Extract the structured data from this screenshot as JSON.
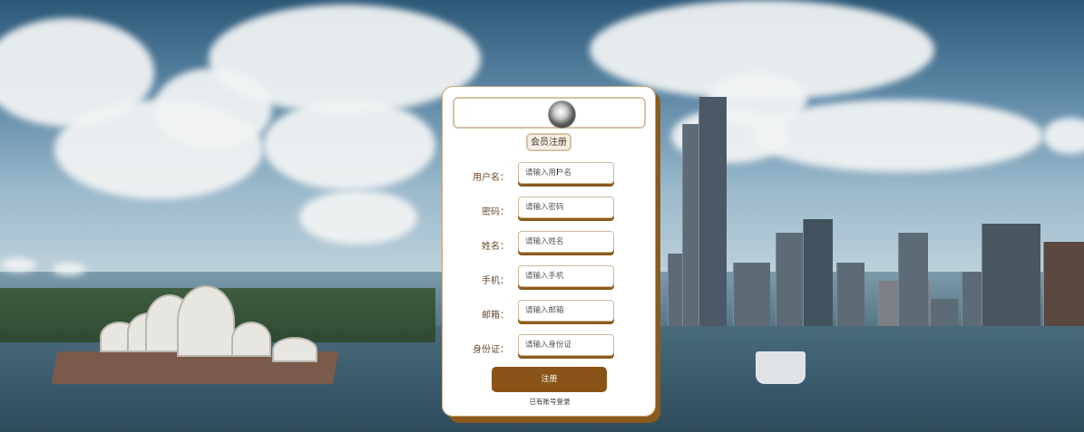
{
  "register": {
    "title_label": "会员注册",
    "fields": [
      {
        "label": "用户名：",
        "placeholder": "请输入用户名"
      },
      {
        "label": "密码：",
        "placeholder": "请输入密码"
      },
      {
        "label": "姓名：",
        "placeholder": "请输入姓名"
      },
      {
        "label": "手机：",
        "placeholder": "请输入手机"
      },
      {
        "label": "邮箱：",
        "placeholder": "请输入邮箱"
      },
      {
        "label": "身份证：",
        "placeholder": "请输入身份证"
      }
    ],
    "submit_label": "注册",
    "login_link": "已有账号登录"
  },
  "colors": {
    "accent": "#8a5418",
    "card_border": "#d6c2a6"
  },
  "icons": {
    "avatar": "avatar-image"
  }
}
